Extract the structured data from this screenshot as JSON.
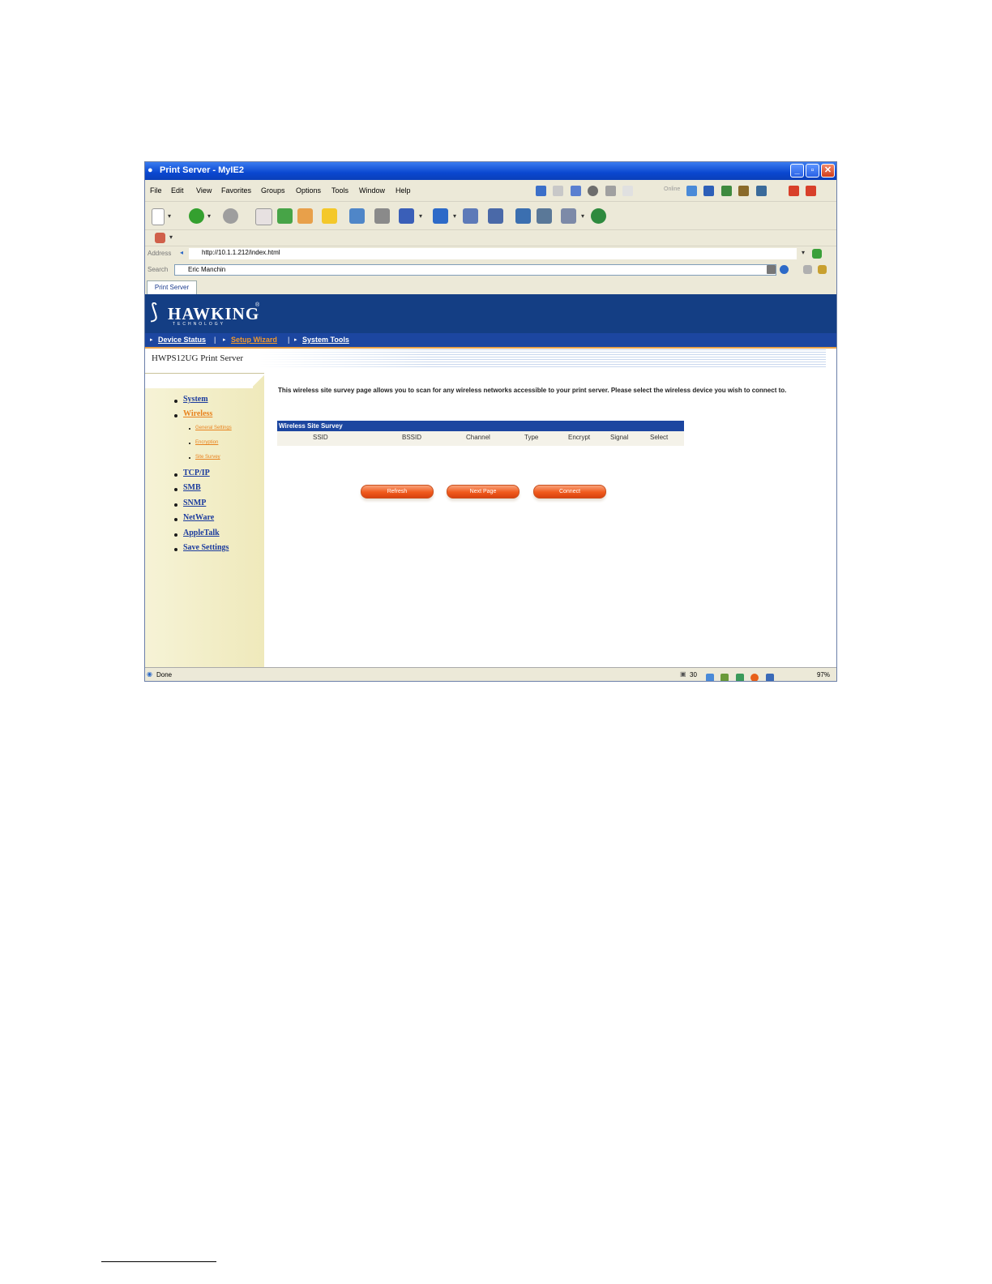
{
  "window": {
    "title": "Print Server - MyIE2",
    "title_icon": "ie-icon"
  },
  "menu": [
    "File",
    "Edit",
    "View",
    "Favorites",
    "Groups",
    "Options",
    "Tools",
    "Window",
    "Help"
  ],
  "menu_right_label": "Online",
  "address": {
    "label": "Address",
    "url": "http://10.1.1.212/index.html"
  },
  "search": {
    "label": "Search",
    "value": "Eric Manchin"
  },
  "tab": {
    "label": "Print Server"
  },
  "brand": {
    "name": "HAWKING",
    "sub": "TECHNOLOGY",
    "reg": "®"
  },
  "nav": {
    "device_status": "Device Status",
    "setup_wizard": "Setup Wizard",
    "system_tools": "System Tools",
    "sep": "|"
  },
  "page_title": "HWPS12UG Print Server",
  "sidebar": {
    "items": [
      {
        "label": "System"
      },
      {
        "label": "Wireless"
      },
      {
        "label": "TCP/IP"
      },
      {
        "label": "SMB"
      },
      {
        "label": "SNMP"
      },
      {
        "label": "NetWare"
      },
      {
        "label": "AppleTalk"
      },
      {
        "label": "Save Settings"
      }
    ],
    "subitems": [
      {
        "label": "General Settings"
      },
      {
        "label": "Encryption"
      },
      {
        "label": "Site Survey"
      }
    ]
  },
  "description": "This wireless site survey page allows you to scan for any wireless networks accessible to your print server. Please select the wireless device you wish to connect to.",
  "survey": {
    "title": "Wireless Site Survey",
    "columns": [
      "SSID",
      "BSSID",
      "Channel",
      "Type",
      "Encrypt",
      "Signal",
      "Select"
    ]
  },
  "buttons": {
    "refresh": "Refresh",
    "next_page": "Next Page",
    "connect": "Connect"
  },
  "status": {
    "text": "Done",
    "count": "30",
    "percent": "97%"
  }
}
